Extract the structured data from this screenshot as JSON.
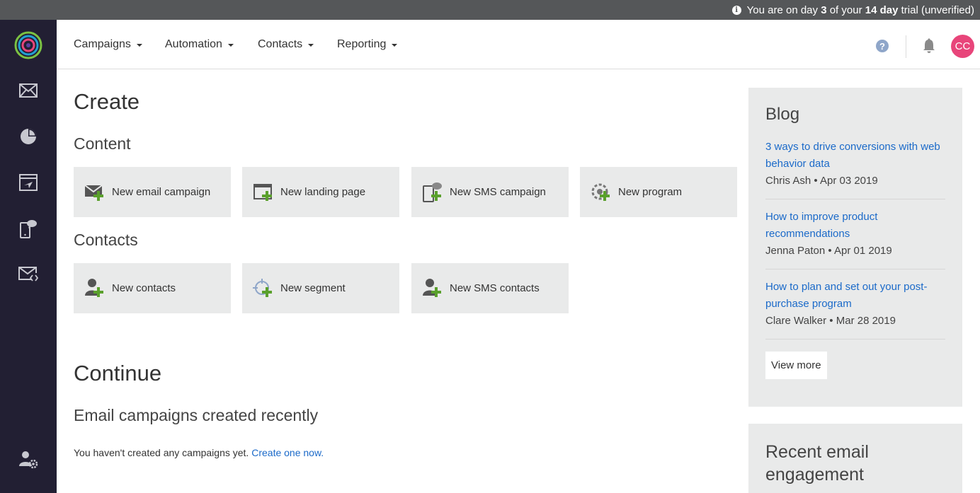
{
  "trial": {
    "prefix": "You are on day ",
    "day": "3",
    "middle": " of your ",
    "length": "14 day",
    "suffix": " trial (unverified)"
  },
  "sidebar": {
    "icons": [
      "logo",
      "envelope-icon",
      "pie-chart-icon",
      "automation-icon",
      "sms-icon",
      "email-code-icon",
      "user-settings-icon"
    ]
  },
  "nav": {
    "items": [
      "Campaigns",
      "Automation",
      "Contacts",
      "Reporting"
    ],
    "avatar_initials": "CC",
    "help_glyph": "?"
  },
  "create": {
    "title": "Create",
    "content_heading": "Content",
    "content_tiles": [
      {
        "label": "New email campaign",
        "icon": "email-add-icon"
      },
      {
        "label": "New landing page",
        "icon": "landing-page-add-icon"
      },
      {
        "label": "New SMS campaign",
        "icon": "sms-add-icon"
      },
      {
        "label": "New program",
        "icon": "program-add-icon"
      }
    ],
    "contacts_heading": "Contacts",
    "contact_tiles": [
      {
        "label": "New contacts",
        "icon": "contact-add-icon"
      },
      {
        "label": "New segment",
        "icon": "segment-add-icon"
      },
      {
        "label": "New SMS contacts",
        "icon": "sms-contact-add-icon"
      }
    ]
  },
  "continue": {
    "title": "Continue",
    "subheading": "Email campaigns created recently",
    "empty_text": "You haven't created any campaigns yet. ",
    "empty_link": "Create one now."
  },
  "blog": {
    "title": "Blog",
    "posts": [
      {
        "title": "3 ways to drive conversions with web behavior data",
        "author": "Chris Ash",
        "date": "Apr 03 2019"
      },
      {
        "title": "How to improve product recommendations",
        "author": "Jenna Paton",
        "date": "Apr 01 2019"
      },
      {
        "title": "How to plan and set out your post-purchase program",
        "author": "Clare Walker",
        "date": "Mar 28 2019"
      }
    ],
    "view_more": "View more"
  },
  "engagement": {
    "title": "Recent email engagement"
  },
  "colors": {
    "sidebar": "#221f33",
    "trial_bar": "#555759",
    "tile": "#e9eaea",
    "link": "#1b6ac9",
    "avatar": "#e8457a",
    "plus": "#5aa02c"
  }
}
